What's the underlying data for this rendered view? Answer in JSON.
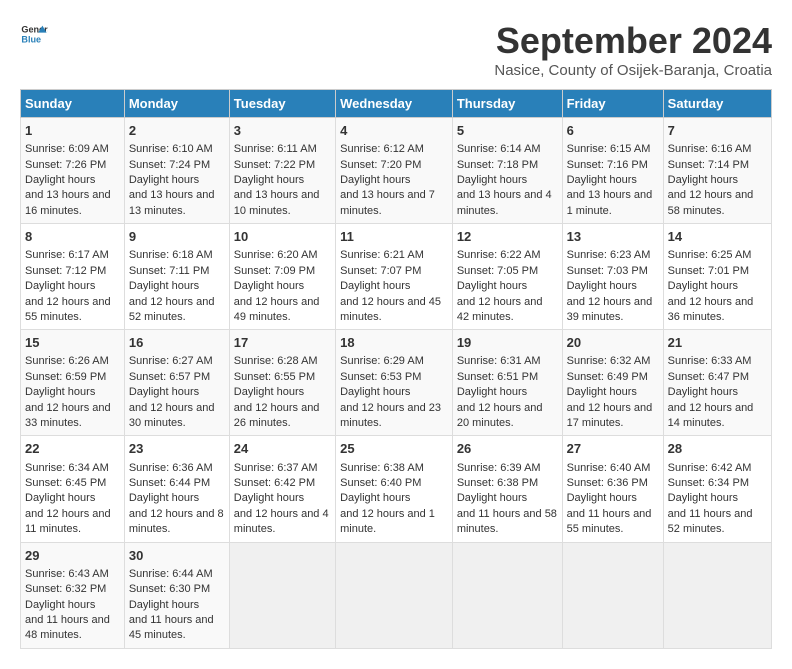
{
  "logo": {
    "text_general": "General",
    "text_blue": "Blue"
  },
  "title": "September 2024",
  "location": "Nasice, County of Osijek-Baranja, Croatia",
  "days_of_week": [
    "Sunday",
    "Monday",
    "Tuesday",
    "Wednesday",
    "Thursday",
    "Friday",
    "Saturday"
  ],
  "weeks": [
    [
      {
        "day": "1",
        "sunrise": "6:09 AM",
        "sunset": "7:26 PM",
        "daylight": "13 hours and 16 minutes."
      },
      {
        "day": "2",
        "sunrise": "6:10 AM",
        "sunset": "7:24 PM",
        "daylight": "13 hours and 13 minutes."
      },
      {
        "day": "3",
        "sunrise": "6:11 AM",
        "sunset": "7:22 PM",
        "daylight": "13 hours and 10 minutes."
      },
      {
        "day": "4",
        "sunrise": "6:12 AM",
        "sunset": "7:20 PM",
        "daylight": "13 hours and 7 minutes."
      },
      {
        "day": "5",
        "sunrise": "6:14 AM",
        "sunset": "7:18 PM",
        "daylight": "13 hours and 4 minutes."
      },
      {
        "day": "6",
        "sunrise": "6:15 AM",
        "sunset": "7:16 PM",
        "daylight": "13 hours and 1 minute."
      },
      {
        "day": "7",
        "sunrise": "6:16 AM",
        "sunset": "7:14 PM",
        "daylight": "12 hours and 58 minutes."
      }
    ],
    [
      {
        "day": "8",
        "sunrise": "6:17 AM",
        "sunset": "7:12 PM",
        "daylight": "12 hours and 55 minutes."
      },
      {
        "day": "9",
        "sunrise": "6:18 AM",
        "sunset": "7:11 PM",
        "daylight": "12 hours and 52 minutes."
      },
      {
        "day": "10",
        "sunrise": "6:20 AM",
        "sunset": "7:09 PM",
        "daylight": "12 hours and 49 minutes."
      },
      {
        "day": "11",
        "sunrise": "6:21 AM",
        "sunset": "7:07 PM",
        "daylight": "12 hours and 45 minutes."
      },
      {
        "day": "12",
        "sunrise": "6:22 AM",
        "sunset": "7:05 PM",
        "daylight": "12 hours and 42 minutes."
      },
      {
        "day": "13",
        "sunrise": "6:23 AM",
        "sunset": "7:03 PM",
        "daylight": "12 hours and 39 minutes."
      },
      {
        "day": "14",
        "sunrise": "6:25 AM",
        "sunset": "7:01 PM",
        "daylight": "12 hours and 36 minutes."
      }
    ],
    [
      {
        "day": "15",
        "sunrise": "6:26 AM",
        "sunset": "6:59 PM",
        "daylight": "12 hours and 33 minutes."
      },
      {
        "day": "16",
        "sunrise": "6:27 AM",
        "sunset": "6:57 PM",
        "daylight": "12 hours and 30 minutes."
      },
      {
        "day": "17",
        "sunrise": "6:28 AM",
        "sunset": "6:55 PM",
        "daylight": "12 hours and 26 minutes."
      },
      {
        "day": "18",
        "sunrise": "6:29 AM",
        "sunset": "6:53 PM",
        "daylight": "12 hours and 23 minutes."
      },
      {
        "day": "19",
        "sunrise": "6:31 AM",
        "sunset": "6:51 PM",
        "daylight": "12 hours and 20 minutes."
      },
      {
        "day": "20",
        "sunrise": "6:32 AM",
        "sunset": "6:49 PM",
        "daylight": "12 hours and 17 minutes."
      },
      {
        "day": "21",
        "sunrise": "6:33 AM",
        "sunset": "6:47 PM",
        "daylight": "12 hours and 14 minutes."
      }
    ],
    [
      {
        "day": "22",
        "sunrise": "6:34 AM",
        "sunset": "6:45 PM",
        "daylight": "12 hours and 11 minutes."
      },
      {
        "day": "23",
        "sunrise": "6:36 AM",
        "sunset": "6:44 PM",
        "daylight": "12 hours and 8 minutes."
      },
      {
        "day": "24",
        "sunrise": "6:37 AM",
        "sunset": "6:42 PM",
        "daylight": "12 hours and 4 minutes."
      },
      {
        "day": "25",
        "sunrise": "6:38 AM",
        "sunset": "6:40 PM",
        "daylight": "12 hours and 1 minute."
      },
      {
        "day": "26",
        "sunrise": "6:39 AM",
        "sunset": "6:38 PM",
        "daylight": "11 hours and 58 minutes."
      },
      {
        "day": "27",
        "sunrise": "6:40 AM",
        "sunset": "6:36 PM",
        "daylight": "11 hours and 55 minutes."
      },
      {
        "day": "28",
        "sunrise": "6:42 AM",
        "sunset": "6:34 PM",
        "daylight": "11 hours and 52 minutes."
      }
    ],
    [
      {
        "day": "29",
        "sunrise": "6:43 AM",
        "sunset": "6:32 PM",
        "daylight": "11 hours and 48 minutes."
      },
      {
        "day": "30",
        "sunrise": "6:44 AM",
        "sunset": "6:30 PM",
        "daylight": "11 hours and 45 minutes."
      },
      null,
      null,
      null,
      null,
      null
    ]
  ],
  "labels": {
    "sunrise": "Sunrise:",
    "sunset": "Sunset:",
    "daylight": "Daylight hours"
  }
}
